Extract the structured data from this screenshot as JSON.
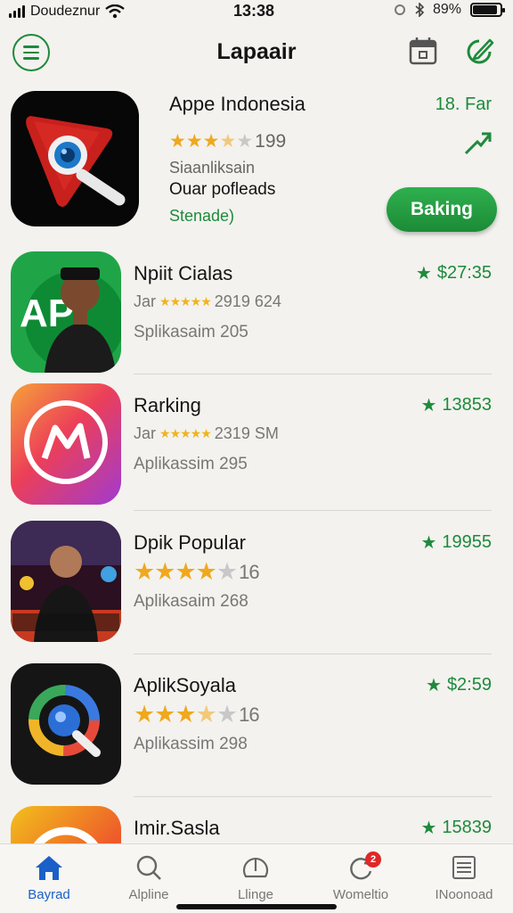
{
  "status_bar": {
    "carrier": "Doudeznur",
    "time": "13:38",
    "battery_percent": "89%",
    "battery_level": 0.89
  },
  "header": {
    "title": "Lapaair"
  },
  "featured": {
    "name": "Appe Indonesia",
    "rank": "18. Far",
    "rating": 3.5,
    "rating_count": "199",
    "subtitle_1": "Siaanliksain",
    "subtitle_2": "Ouar pofleads",
    "subtitle_3": "Stenade)",
    "button_label": "Baking"
  },
  "apps": [
    {
      "name": "Npiit Cialas",
      "price": "$27:35",
      "meta_prefix": "Jar",
      "meta_text": "2919 624",
      "subtitle": "Splikasaim 205"
    },
    {
      "name": "Rarking",
      "price": "13853",
      "meta_prefix": "Jar",
      "meta_text": "2319 SM",
      "subtitle": "Aplikassim 295"
    },
    {
      "name": "Dpik Popular",
      "price": "19955",
      "rating": 4,
      "rating_count": "16",
      "subtitle": "Aplikasaim 268"
    },
    {
      "name": "AplikSoyala",
      "price": "$2:59",
      "rating": 3.5,
      "rating_count": "16",
      "subtitle": "Aplikassim 298"
    },
    {
      "name": "Imir.Sasla",
      "price": "15839"
    }
  ],
  "tabs": [
    {
      "label": "Bayrad",
      "icon": "home-icon",
      "active": true
    },
    {
      "label": "Alpline",
      "icon": "search-icon"
    },
    {
      "label": "Llinge",
      "icon": "gauge-icon"
    },
    {
      "label": "Womeltio",
      "icon": "refresh-icon",
      "badge": "2"
    },
    {
      "label": "INoonoad",
      "icon": "list-icon"
    }
  ],
  "colors": {
    "accent_green": "#1e8a3c",
    "active_tab": "#1b5fc8",
    "star": "#f0a81c",
    "badge": "#e02828"
  }
}
